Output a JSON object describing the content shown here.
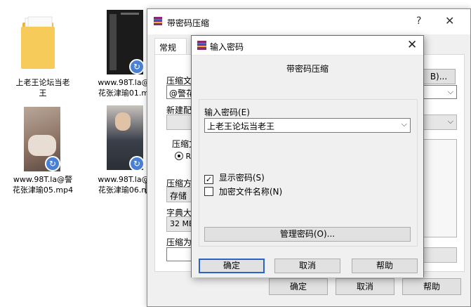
{
  "desktop": {
    "items": [
      {
        "label_line1": "上老王论坛当老",
        "label_line2": "王"
      },
      {
        "label_line1": "www.98T.la@",
        "label_line2": "花张津瑜01.m"
      },
      {
        "label_line1": "www.98T.la@警",
        "label_line2": "花张津瑜05.mp4"
      },
      {
        "label_line1": "www.98T.la@",
        "label_line2": "花张津瑜06.m"
      }
    ]
  },
  "back_dialog": {
    "title": "带密码压缩",
    "help_glyph": "?",
    "close_glyph": "✕",
    "tab_general": "常规",
    "label_archive_name": "压缩文",
    "archive_name_value": "@警花张",
    "browse_button_fragment": "B)...",
    "label_new_profile": "新建配",
    "label_format": "压缩文",
    "radio_rar": "RA",
    "label_method": "压缩方",
    "method_value": "存储",
    "label_dict": "字典大",
    "dict_value": "32 MB",
    "label_split": "压缩为",
    "ok_button": "确定",
    "cancel_button": "取消",
    "help_button": "帮助"
  },
  "front_dialog": {
    "title": "输入密码",
    "close_glyph": "✕",
    "caption": "带密码压缩",
    "label_password": "输入密码(E)",
    "password_value": "上老王论坛当老王",
    "show_password_label": "显示密码(S)",
    "show_password_checked": true,
    "encrypt_names_label": "加密文件名称(N)",
    "encrypt_names_checked": false,
    "manage_button": "管理密码(O)...",
    "ok_button": "确定",
    "cancel_button": "取消",
    "help_button": "帮助"
  },
  "colors": {
    "accent": "#2a63c8",
    "folder": "#f2c24f",
    "share_badge": "#4a7fd6"
  }
}
